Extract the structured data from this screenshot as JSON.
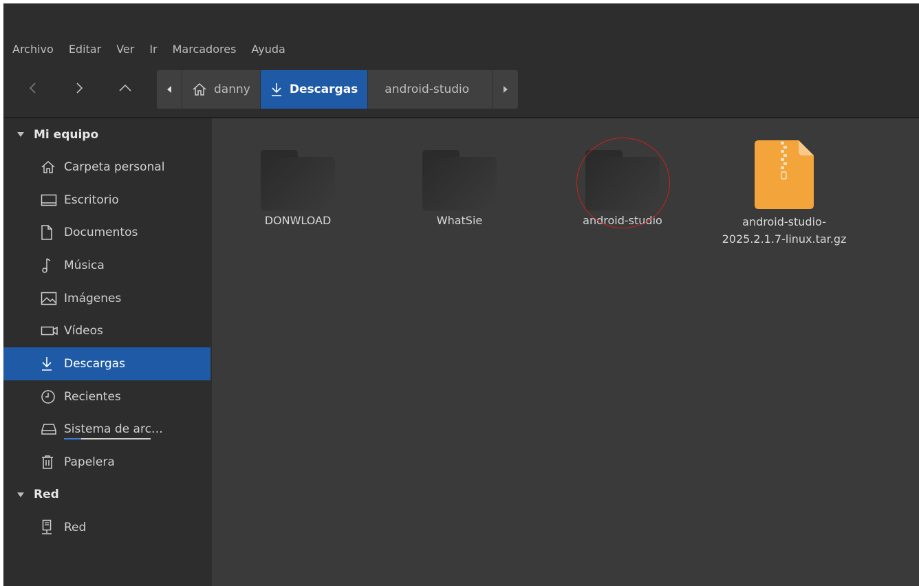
{
  "menu": [
    "Archivo",
    "Editar",
    "Ver",
    "Ir",
    "Marcadores",
    "Ayuda"
  ],
  "breadcrumbs": {
    "home": "danny",
    "current": "Descargas",
    "next": "android-studio"
  },
  "sidebar": {
    "sections": [
      {
        "title": "Mi equipo",
        "items": [
          {
            "label": "Carpeta personal",
            "icon": "home-icon"
          },
          {
            "label": "Escritorio",
            "icon": "desktop-icon"
          },
          {
            "label": "Documentos",
            "icon": "document-icon"
          },
          {
            "label": "Música",
            "icon": "music-icon"
          },
          {
            "label": "Imágenes",
            "icon": "image-icon"
          },
          {
            "label": "Vídeos",
            "icon": "video-icon"
          },
          {
            "label": "Descargas",
            "icon": "download-icon",
            "selected": true
          },
          {
            "label": "Recientes",
            "icon": "clock-icon"
          },
          {
            "label": "Sistema de arc…",
            "icon": "drive-icon",
            "usage": 0.2
          },
          {
            "label": "Papelera",
            "icon": "trash-icon"
          }
        ]
      },
      {
        "title": "Red",
        "items": [
          {
            "label": "Red",
            "icon": "network-icon"
          }
        ]
      }
    ]
  },
  "files": [
    {
      "name": "DONWLOAD",
      "type": "folder"
    },
    {
      "name": "WhatSie",
      "type": "folder"
    },
    {
      "name": "android-studio",
      "type": "folder",
      "highlighted": true
    },
    {
      "name": "android-studio-2025.2.1.7-linux.tar.gz",
      "type": "archive"
    }
  ],
  "colors": {
    "accent": "#1f5aa6",
    "archive": "#f3a53c",
    "highlight_circle": "#cc1f1f"
  }
}
